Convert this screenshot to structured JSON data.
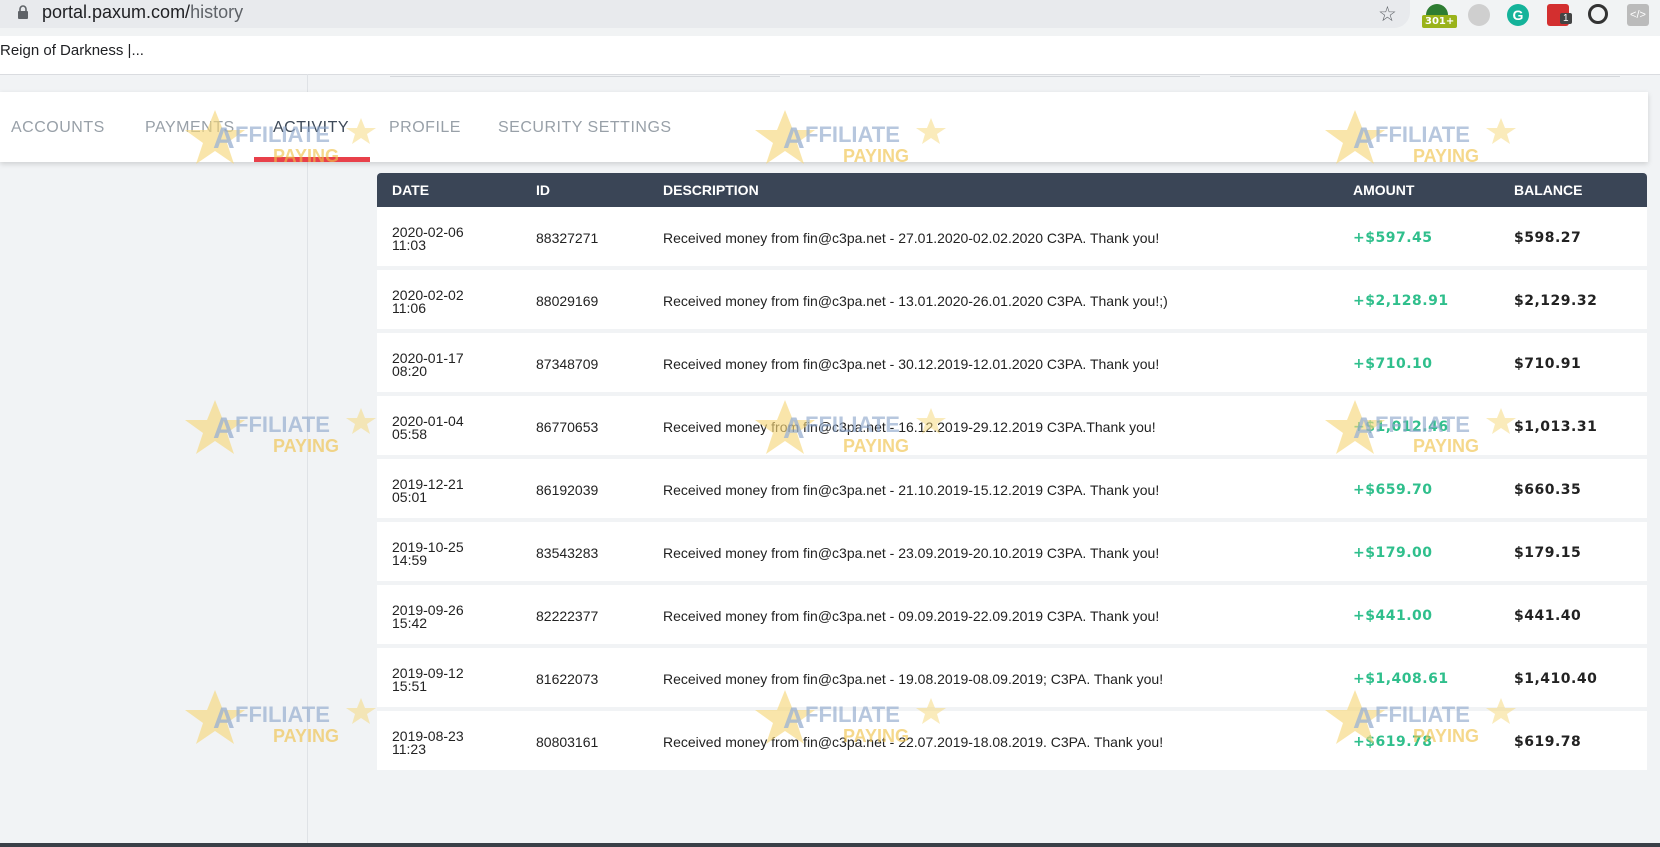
{
  "browser": {
    "url_host": "portal.paxum.com/",
    "url_path": "history",
    "bookmark": "Reign of Darkness |...",
    "ext_badge_1": "301+",
    "ext_badge_2": "1",
    "ext_badge_2_label": "G"
  },
  "tabs": [
    "ACCOUNTS",
    "PAYMENTS",
    "ACTIVITY",
    "PROFILE",
    "SECURITY SETTINGS"
  ],
  "table": {
    "headers": {
      "date": "DATE",
      "id": "ID",
      "description": "DESCRIPTION",
      "amount": "AMOUNT",
      "balance": "BALANCE"
    },
    "rows": [
      {
        "date": "2020-02-06",
        "time": "11:03",
        "id": "88327271",
        "description": "Received money from fin@c3pa.net - 27.01.2020-02.02.2020 C3PA. Thank you!",
        "amount": "+$597.45",
        "balance": "$598.27"
      },
      {
        "date": "2020-02-02",
        "time": "11:06",
        "id": "88029169",
        "description": "Received money from fin@c3pa.net - 13.01.2020-26.01.2020 C3PA. Thank you!;)",
        "amount": "+$2,128.91",
        "balance": "$2,129.32"
      },
      {
        "date": "2020-01-17",
        "time": "08:20",
        "id": "87348709",
        "description": "Received money from fin@c3pa.net - 30.12.2019-12.01.2020 C3PA. Thank you!",
        "amount": "+$710.10",
        "balance": "$710.91"
      },
      {
        "date": "2020-01-04",
        "time": "05:58",
        "id": "86770653",
        "description": "Received money from fin@c3pa.net - 16.12.2019-29.12.2019 C3PA.Thank you!",
        "amount": "+$1,012.46",
        "balance": "$1,013.31"
      },
      {
        "date": "2019-12-21",
        "time": "05:01",
        "id": "86192039",
        "description": "Received money from fin@c3pa.net - 21.10.2019-15.12.2019 C3PA. Thank you!",
        "amount": "+$659.70",
        "balance": "$660.35"
      },
      {
        "date": "2019-10-25",
        "time": "14:59",
        "id": "83543283",
        "description": "Received money from fin@c3pa.net - 23.09.2019-20.10.2019 C3PA. Thank you!",
        "amount": "+$179.00",
        "balance": "$179.15"
      },
      {
        "date": "2019-09-26",
        "time": "15:42",
        "id": "82222377",
        "description": "Received money from fin@c3pa.net - 09.09.2019-22.09.2019 C3PA. Thank you!",
        "amount": "+$441.00",
        "balance": "$441.40"
      },
      {
        "date": "2019-09-12",
        "time": "15:51",
        "id": "81622073",
        "description": "Received money from fin@c3pa.net - 19.08.2019-08.09.2019; C3PA. Thank you!",
        "amount": "+$1,408.61",
        "balance": "$1,410.40"
      },
      {
        "date": "2019-08-23",
        "time": "11:23",
        "id": "80803161",
        "description": "Received money from fin@c3pa.net - 22.07.2019-18.08.2019. C3PA. Thank you!",
        "amount": "+$619.78",
        "balance": "$619.78"
      }
    ]
  },
  "watermark": {
    "line1": "AFFILIATE",
    "line2": "PAYING"
  },
  "colors": {
    "header_bg": "#3a4556",
    "amount_green": "#2fbf8c",
    "active_underline": "#e8404a"
  }
}
